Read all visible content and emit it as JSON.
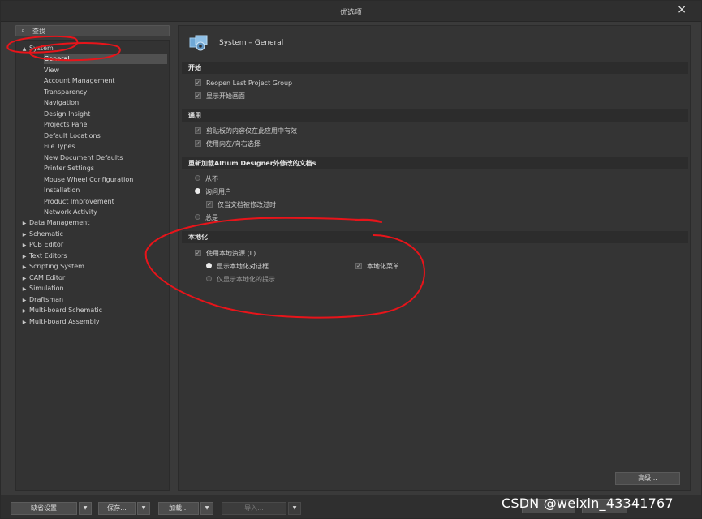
{
  "window": {
    "title": "优选项",
    "close_icon": "×"
  },
  "search": {
    "icon": "⌕",
    "placeholder": "查找"
  },
  "tree": {
    "system": {
      "arrow": "▲",
      "label": "System"
    },
    "system_children": [
      "General",
      "View",
      "Account Management",
      "Transparency",
      "Navigation",
      "Design Insight",
      "Projects Panel",
      "Default Locations",
      "File Types",
      "New Document Defaults",
      "Printer Settings",
      "Mouse Wheel Configuration",
      "Installation",
      "Product Improvement",
      "Network Activity"
    ],
    "collapsed_arrow": "▶",
    "top_level": [
      "Data Management",
      "Schematic",
      "PCB Editor",
      "Text Editors",
      "Scripting System",
      "CAM Editor",
      "Simulation",
      "Draftsman",
      "Multi-board Schematic",
      "Multi-board Assembly"
    ]
  },
  "page": {
    "title": "System – General",
    "icon": "system-general-icon"
  },
  "sections": {
    "start": {
      "header": "开始",
      "options": [
        {
          "label": "Reopen Last Project Group",
          "checked": true
        },
        {
          "label": "显示开始画面",
          "checked": true
        }
      ]
    },
    "general": {
      "header": "通用",
      "options": [
        {
          "label": "剪贴板的内容仅在此应用中有效",
          "checked": true
        },
        {
          "label": "使用向左/向右选择",
          "checked": true
        }
      ]
    },
    "reload": {
      "header": "重新加载Altium Designer外修改的文档s",
      "never": "从不",
      "ask": "询问用户",
      "only_when_modified": "仅当文档被修改过时",
      "always": "总是"
    },
    "localization": {
      "header": "本地化",
      "use_local_resources": "使用本地资源 (L)",
      "show_localized_dialogs": "显示本地化对话框",
      "localized_menus": "本地化菜单",
      "show_localized_hints_only": "仅显示本地化的提示"
    }
  },
  "buttons": {
    "advanced": "高级...",
    "default_settings": "缺省设置",
    "save": "保存...",
    "load": "加载...",
    "import": "导入...",
    "dropdown_glyph": "▼"
  },
  "watermark": "CSDN @weixin_43341767",
  "colors": {
    "annotation": "#e8141a",
    "background": "#3a3a3a",
    "section_header": "#2c2c2c"
  }
}
